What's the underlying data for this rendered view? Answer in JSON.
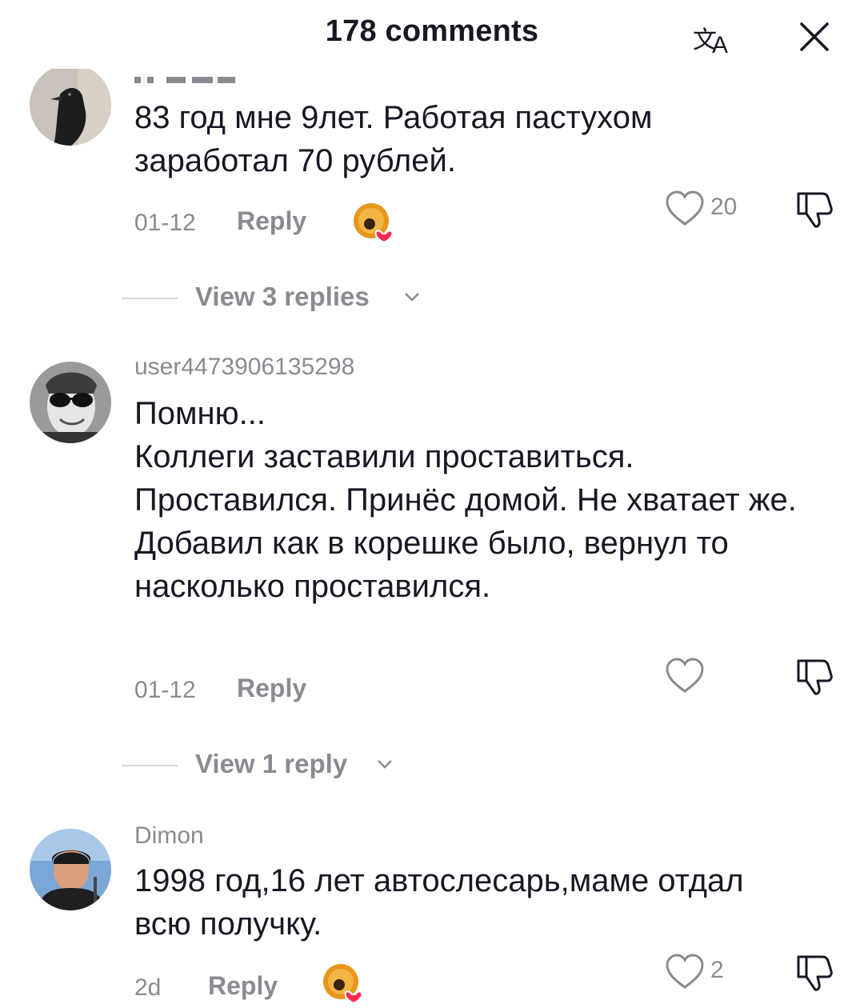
{
  "header": {
    "title": "178 comments",
    "translate_icon": "translate-icon",
    "close_icon": "close-icon"
  },
  "comments": [
    {
      "username": "",
      "text": "83 год мне 9лет. Работая пастухом заработал 70 рублей.",
      "date": "01-12",
      "reply_label": "Reply",
      "likes": "20",
      "creator_liked": true,
      "view_replies": "View 3 replies"
    },
    {
      "username": "user4473906135298",
      "text": "Помню...\nКоллеги заставили проставиться. Проставился. Принёс домой. Не хватает же. Добавил как в корешке было, вернул то насколько проставился.",
      "date": "01-12",
      "reply_label": "Reply",
      "likes": "",
      "creator_liked": false,
      "view_replies": "View 1 reply"
    },
    {
      "username": "Dimon",
      "text": "1998 год,16 лет автослесарь,маме отдал всю получку.",
      "date": "2d",
      "reply_label": "Reply",
      "likes": "2",
      "creator_liked": true
    }
  ],
  "colors": {
    "text_primary": "#161823",
    "text_secondary": "#8a8b91",
    "heart_badge": "#fe2c55",
    "badge_gold": "#e8951c"
  },
  "icons": [
    "heart-outline-icon",
    "dislike-icon",
    "chevron-down-icon",
    "creator-heart-badge-icon"
  ]
}
